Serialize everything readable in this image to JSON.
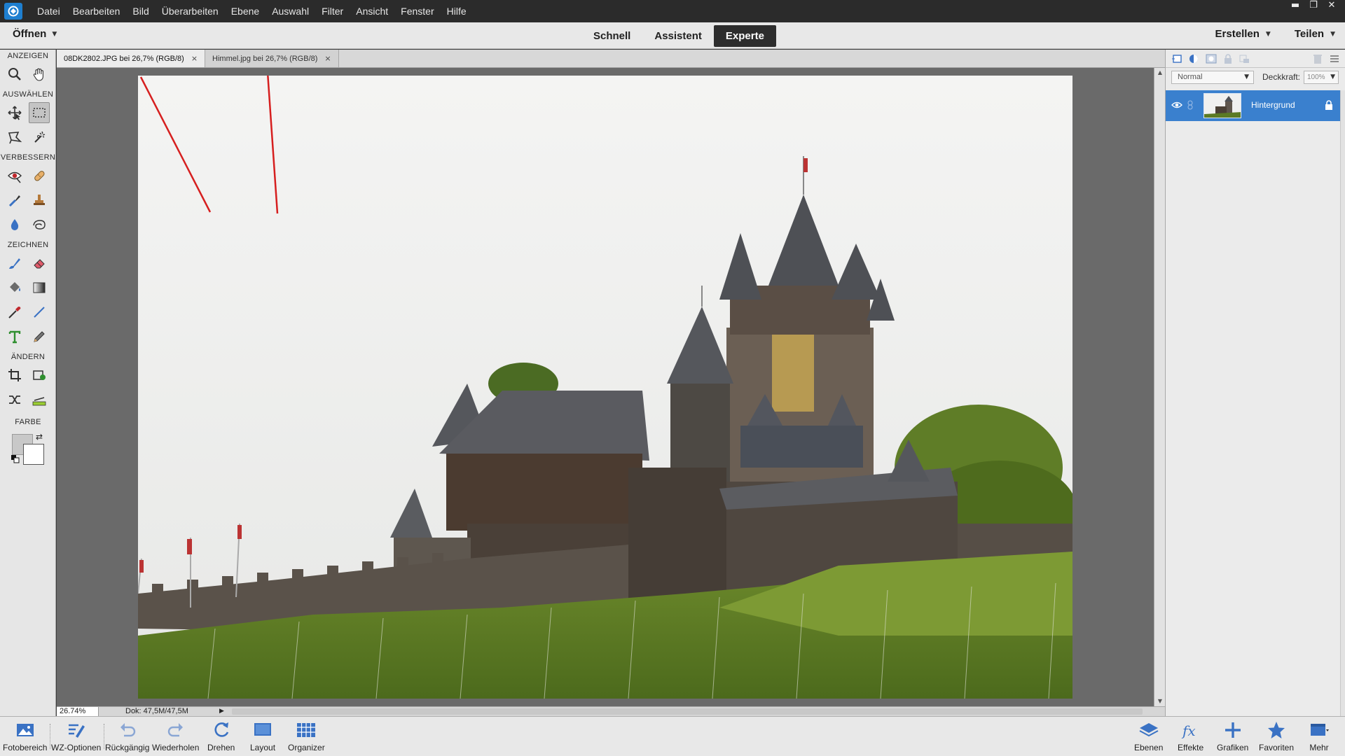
{
  "menu": {
    "items": [
      "Datei",
      "Bearbeiten",
      "Bild",
      "Überarbeiten",
      "Ebene",
      "Auswahl",
      "Filter",
      "Ansicht",
      "Fenster",
      "Hilfe"
    ]
  },
  "window_controls": {
    "minimize": "▬",
    "restore": "❐",
    "close": "✕"
  },
  "modebar": {
    "open_label": "Öffnen",
    "modes": [
      "Schnell",
      "Assistent",
      "Experte"
    ],
    "active_mode": "Experte",
    "create_label": "Erstellen",
    "share_label": "Teilen"
  },
  "toolbox": {
    "sections": [
      "ANZEIGEN",
      "AUSWÄHLEN",
      "VERBESSERN",
      "ZEICHNEN",
      "ÄNDERN",
      "FARBE"
    ],
    "selected_tool": "rectangular-marquee-tool",
    "foreground_color": "#c8c8c8",
    "background_color": "#ffffff"
  },
  "doc_tabs": [
    {
      "label": "08DK2802.JPG bei 26,7% (RGB/8)",
      "active": true,
      "close": "×"
    },
    {
      "label": "Himmel.jpg bei 26,7% (RGB/8)",
      "active": false,
      "close": "×"
    }
  ],
  "status": {
    "zoom": "26.74%",
    "doc_info": "Dok: 47,5M/47,5M"
  },
  "layers_panel": {
    "blend_mode": "Normal",
    "opacity_label": "Deckkraft:",
    "opacity_value": "100%",
    "layers": [
      {
        "name": "Hintergrund",
        "selected": true
      }
    ]
  },
  "bottom_bar": {
    "left": [
      "Fotobereich",
      "WZ-Optionen",
      "Rückgängig",
      "Wiederholen",
      "Drehen",
      "Layout",
      "Organizer"
    ],
    "right": [
      "Ebenen",
      "Effekte",
      "Grafiken",
      "Favoriten",
      "Mehr"
    ]
  },
  "colors": {
    "accent_blue": "#3a80ce",
    "annotation_red": "#d61f1f",
    "menubar_bg": "#2b2b2b",
    "canvas_bg": "#6a6a6a"
  }
}
